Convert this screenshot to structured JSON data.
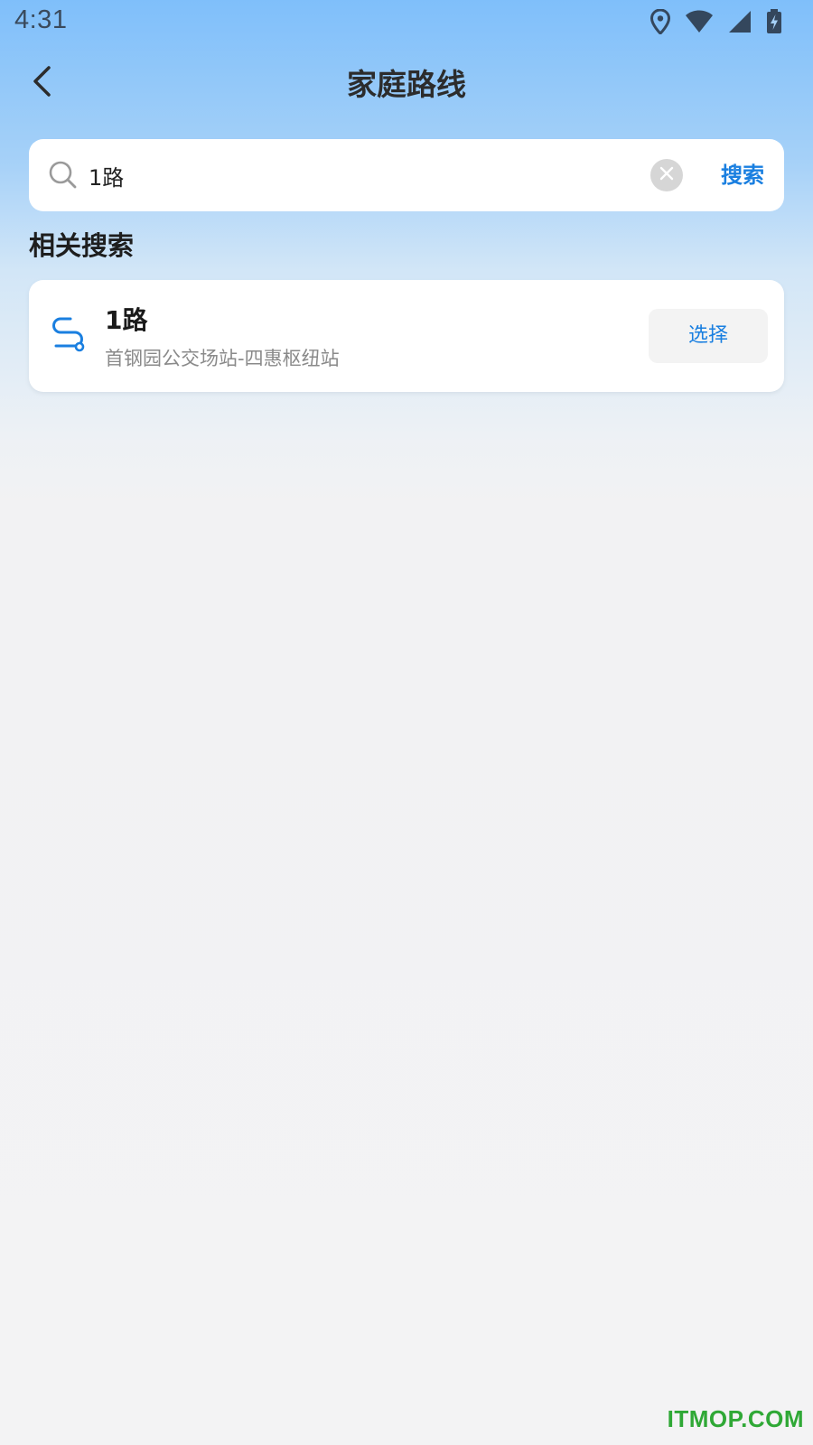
{
  "status_bar": {
    "time": "4:31",
    "icons": [
      "location-icon",
      "wifi-icon",
      "signal-icon",
      "battery-charging-icon"
    ]
  },
  "header": {
    "back_icon": "chevron-left-icon",
    "title": "家庭路线"
  },
  "search": {
    "icon": "search-icon",
    "value": "1路",
    "placeholder": "",
    "clear_icon": "close-icon",
    "button_label": "搜索"
  },
  "related": {
    "heading": "相关搜索",
    "results": [
      {
        "icon": "route-icon",
        "name": "1路",
        "description": "首钢园公交场站-四惠枢纽站",
        "select_label": "选择"
      }
    ]
  },
  "watermark": "ITMOP.COM",
  "colors": {
    "accent": "#1a7fe0",
    "header_gradient_top": "#7fbffa",
    "background": "#f3f3f4",
    "watermark": "#2fa836"
  }
}
